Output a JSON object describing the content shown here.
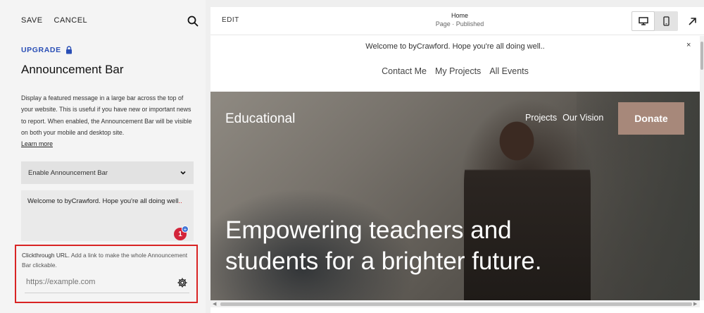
{
  "editor": {
    "save_label": "SAVE",
    "cancel_label": "CANCEL",
    "upgrade_label": "UPGRADE",
    "panel_title": "Announcement Bar",
    "description": "Display a featured message in a large bar across the top of your website. This is useful if you have new or important news to report. When enabled, the Announcement Bar will be visible on both your mobile and desktop site.",
    "learn_more": "Learn more",
    "toggle_select": {
      "selected": "Enable Announcement Bar"
    },
    "message_text": "Welcome to byCrawford. Hope you're all doing well",
    "message_squiggle": "..",
    "notification_count": "1",
    "clickthrough": {
      "label": "Clickthrough URL.",
      "help": " Add a link to make the whole Announcement Bar clickable.",
      "placeholder": "https://example.com"
    }
  },
  "preview": {
    "edit_label": "EDIT",
    "page_name": "Home",
    "page_status": "Page · Published",
    "announcement": "Welcome to byCrawford. Hope you're all doing well..",
    "close_symbol": "×",
    "nav": [
      "Contact Me",
      "My Projects",
      "All Events"
    ],
    "hero": {
      "brand": "Educational",
      "links": [
        "Projects",
        "Our Vision"
      ],
      "donate_label": "Donate",
      "headline": "Empowering teachers and students for a brighter future."
    }
  },
  "colors": {
    "accent_blue": "#2a4fb6",
    "highlight_red": "#d92424",
    "donate_bg": "#a7887a"
  }
}
